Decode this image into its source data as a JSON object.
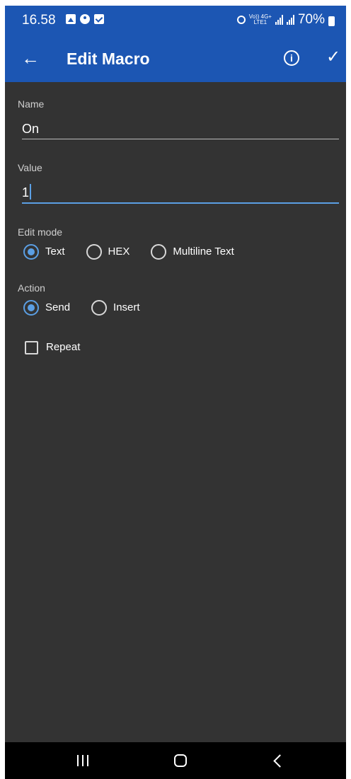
{
  "status_bar": {
    "time": "16.58",
    "network_label_top": "Vo)) 4G+",
    "network_label_bottom": "LTE1",
    "battery": "70%"
  },
  "app_bar": {
    "back_icon": "←",
    "title": "Edit Macro",
    "info_icon": "i",
    "confirm_icon": "✓"
  },
  "form": {
    "name": {
      "label": "Name",
      "value": "On"
    },
    "value": {
      "label": "Value",
      "value": "1"
    },
    "edit_mode": {
      "label": "Edit mode",
      "options": [
        "Text",
        "HEX",
        "Multiline Text"
      ],
      "selected": "Text"
    },
    "action": {
      "label": "Action",
      "options": [
        "Send",
        "Insert"
      ],
      "selected": "Send"
    },
    "repeat": {
      "label": "Repeat",
      "checked": false
    }
  },
  "colors": {
    "app_bar": "#1c56b3",
    "background": "#333333",
    "accent": "#5b9fe4"
  }
}
